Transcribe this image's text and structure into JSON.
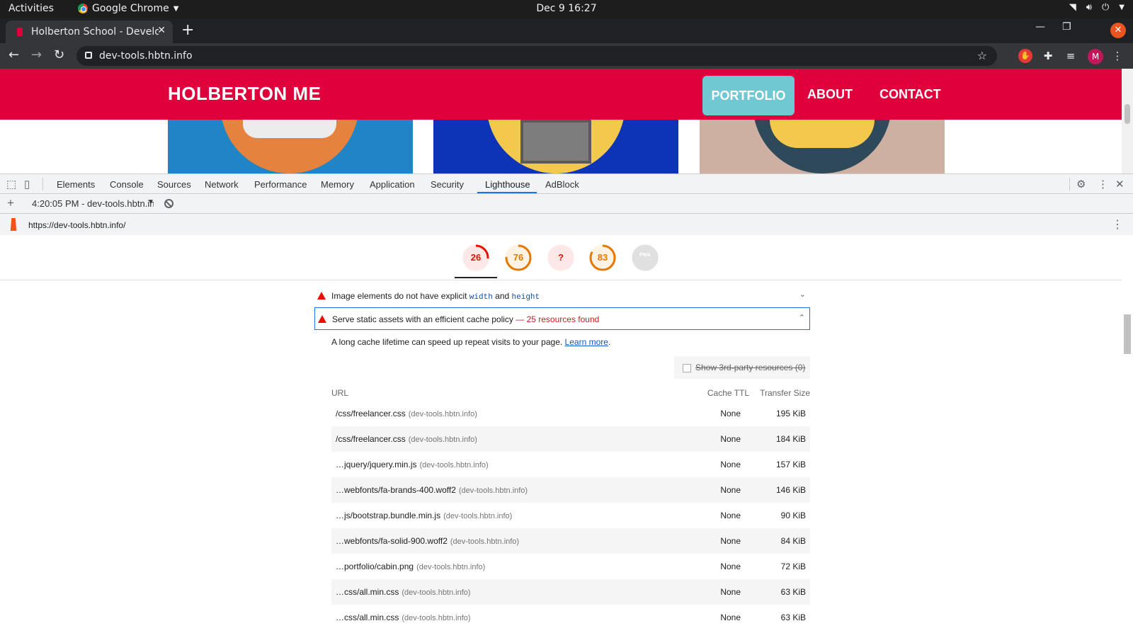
{
  "os": {
    "activities": "Activities",
    "app_name": "Google Chrome",
    "clock": "Dec 9  16:27"
  },
  "browser": {
    "tab_title": "Holberton School - Develo",
    "url": "dev-tools.hbtn.info",
    "avatar_letter": "M"
  },
  "site": {
    "brand": "HOLBERTON ME",
    "nav": [
      "PORTFOLIO",
      "ABOUT",
      "CONTACT"
    ],
    "accent": "#e0003c",
    "nav_active_color": "#70c8d2"
  },
  "devtools": {
    "tabs": [
      "Elements",
      "Console",
      "Sources",
      "Network",
      "Performance",
      "Memory",
      "Application",
      "Security",
      "Lighthouse",
      "AdBlock"
    ],
    "active_tab": "Lighthouse",
    "report_select": "4:20:05 PM - dev-tools.hbtn.info",
    "report_url": "https://dev-tools.hbtn.info/",
    "scores": [
      {
        "value": "26",
        "score": 26,
        "color": "#eb0f00",
        "bg": "#fde8e7"
      },
      {
        "value": "76",
        "score": 76,
        "color": "#e67700",
        "bg": "#fef3e2"
      },
      {
        "value": "?",
        "score": 0,
        "color": "#eb0f00",
        "bg": "#fde8e7"
      },
      {
        "value": "83",
        "score": 83,
        "color": "#e67700",
        "bg": "#fef3e2"
      },
      {
        "value": "PWA",
        "score": 0,
        "color": "#9e9e9e",
        "bg": "#e0e0e0"
      }
    ]
  },
  "audits": {
    "image_size": {
      "prefix": "Image elements do not have explicit",
      "code1": "width",
      "mid": "and",
      "code2": "height"
    },
    "cache_policy": {
      "title": "Serve static assets with an efficient cache policy",
      "found": "— 25 resources found",
      "description": "A long cache lifetime can speed up repeat visits to your page.",
      "learn_more": "Learn more",
      "third_party_label": "Show 3rd-party resources",
      "third_party_count": "(0)",
      "columns": [
        "URL",
        "Cache TTL",
        "Transfer Size"
      ],
      "rows": [
        {
          "path": "/css/freelancer.css",
          "host": "(dev-tools.hbtn.info)",
          "ttl": "None",
          "size": "195 KiB"
        },
        {
          "path": "/css/freelancer.css",
          "host": "(dev-tools.hbtn.info)",
          "ttl": "None",
          "size": "184 KiB"
        },
        {
          "path": "…jquery/jquery.min.js",
          "host": "(dev-tools.hbtn.info)",
          "ttl": "None",
          "size": "157 KiB"
        },
        {
          "path": "…webfonts/fa-brands-400.woff2",
          "host": "(dev-tools.hbtn.info)",
          "ttl": "None",
          "size": "146 KiB"
        },
        {
          "path": "…js/bootstrap.bundle.min.js",
          "host": "(dev-tools.hbtn.info)",
          "ttl": "None",
          "size": "90 KiB"
        },
        {
          "path": "…webfonts/fa-solid-900.woff2",
          "host": "(dev-tools.hbtn.info)",
          "ttl": "None",
          "size": "84 KiB"
        },
        {
          "path": "…portfolio/cabin.png",
          "host": "(dev-tools.hbtn.info)",
          "ttl": "None",
          "size": "72 KiB"
        },
        {
          "path": "…css/all.min.css",
          "host": "(dev-tools.hbtn.info)",
          "ttl": "None",
          "size": "63 KiB"
        },
        {
          "path": "…css/all.min.css",
          "host": "(dev-tools.hbtn.info)",
          "ttl": "None",
          "size": "63 KiB"
        }
      ]
    }
  }
}
